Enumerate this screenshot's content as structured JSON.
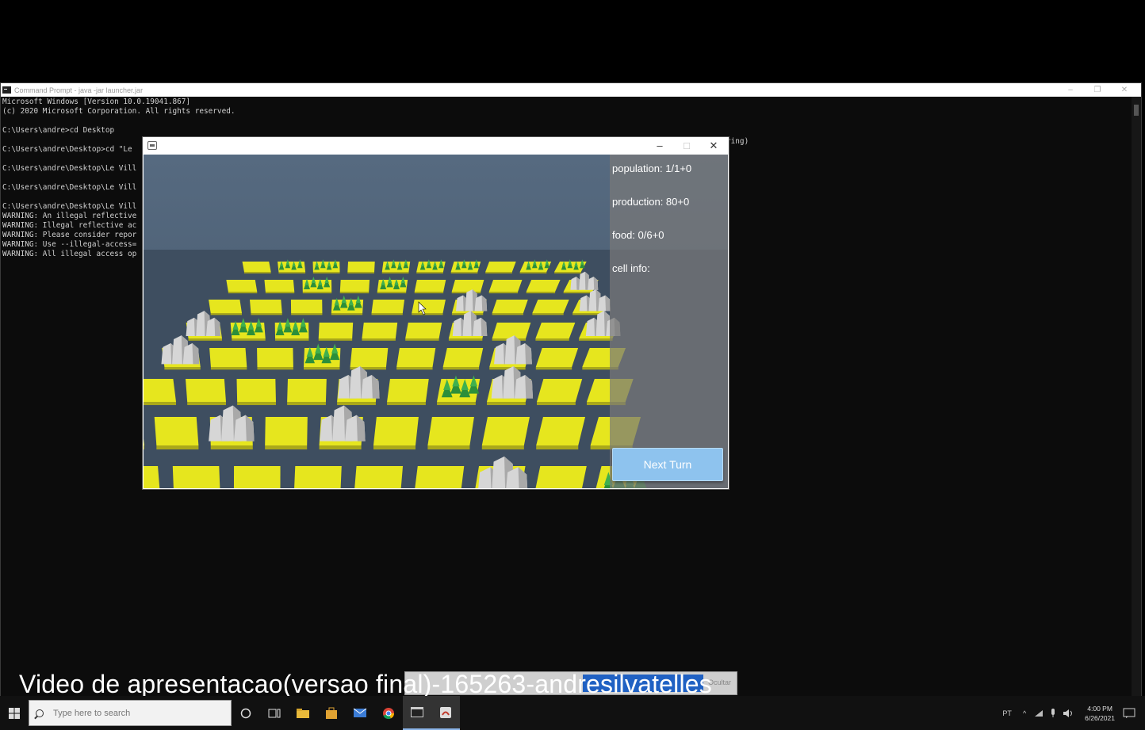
{
  "cmd": {
    "title": "Command Prompt - java -jar launcher.jar",
    "lines": [
      "Microsoft Windows [Version 10.0.19041.867]",
      "(c) 2020 Microsoft Corporation. All rights reserved.",
      "",
      "C:\\Users\\andre>cd Desktop",
      "",
      "C:\\Users\\andre\\Desktop>cd \"Le",
      "",
      "C:\\Users\\andre\\Desktop\\Le Vill",
      "",
      "C:\\Users\\andre\\Desktop\\Le Vill",
      "",
      "C:\\Users\\andre\\Desktop\\Le Vill",
      "WARNING: An illegal reflective",
      "WARNING: Illegal reflective ac",
      "WARNING: Please consider repor",
      "WARNING: Use --illegal-access=",
      "WARNING: All illegal access op"
    ],
    "side_text": "ring)"
  },
  "game": {
    "hud": {
      "population": "population: 1/1+0",
      "production": "production: 80+0",
      "food": "food: 0/6+0",
      "cell_info": "cell info:"
    },
    "next_turn_label": "Next Turn"
  },
  "overlay": {
    "hide_label": "Ocultar"
  },
  "caption": "Video de apresentacao(versao final)-165263-andresilvatelles",
  "taskbar": {
    "search_placeholder": "Type here to search",
    "lang": "PT",
    "time": "4:00 PM",
    "date": "6/26/2021"
  },
  "colors": {
    "background": "#000000",
    "field_yellow": "#e6e61e",
    "forest_green": "#2f9a3f",
    "mountain_gray": "#cfcfcf",
    "sky": "#4d5f74",
    "button": "#8ec3ee"
  }
}
